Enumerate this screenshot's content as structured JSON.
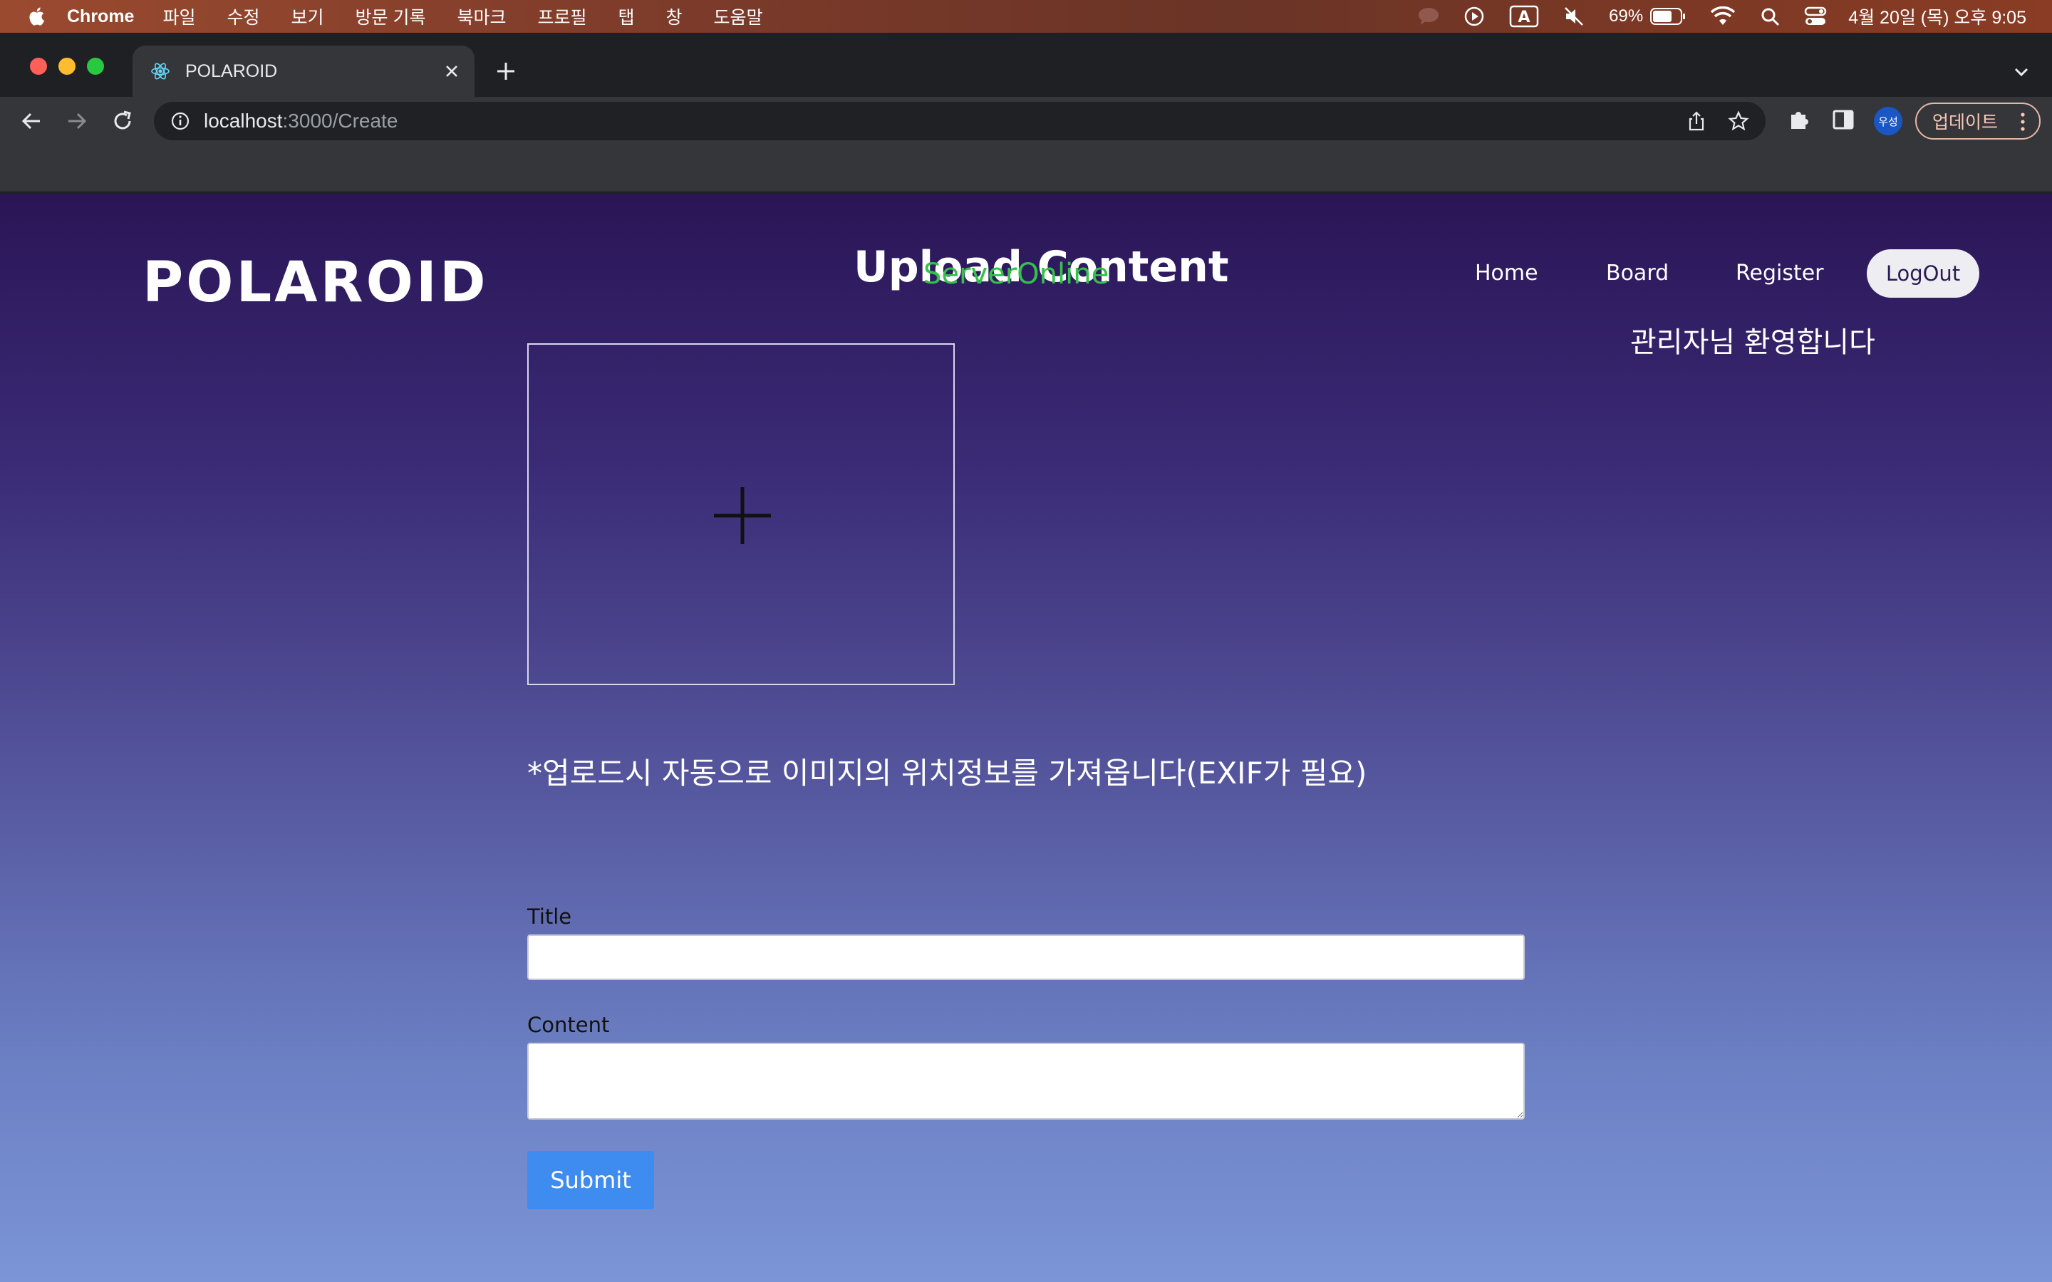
{
  "menubar": {
    "app_name": "Chrome",
    "items": [
      "파일",
      "수정",
      "보기",
      "방문 기록",
      "북마크",
      "프로필",
      "탭",
      "창",
      "도움말"
    ],
    "battery": "69%",
    "clock": "4월 20일 (목) 오후 9:05"
  },
  "browser": {
    "tab_title": "POLAROID",
    "url_host": "localhost",
    "url_path": ":3000/Create",
    "update_label": "업데이트",
    "profile_initials": "우성"
  },
  "page": {
    "logo": "POLAROID",
    "heading": "Upload Content",
    "server_status": "ServerOnline",
    "nav": {
      "home": "Home",
      "board": "Board",
      "register": "Register",
      "logout": "LogOut"
    },
    "welcome": "관리자님 환영합니다",
    "exif_note": "*업로드시 자동으로 이미지의 위치정보를 가져옵니다(EXIF가 필요)",
    "form": {
      "title_label": "Title",
      "title_value": "",
      "content_label": "Content",
      "content_value": "",
      "submit_label": "Submit"
    }
  },
  "colors": {
    "server_status": "#34c14a",
    "submit_button": "#3f8cf0",
    "page_gradient_top": "#2a1556",
    "page_gradient_bottom": "#7b95d6"
  }
}
